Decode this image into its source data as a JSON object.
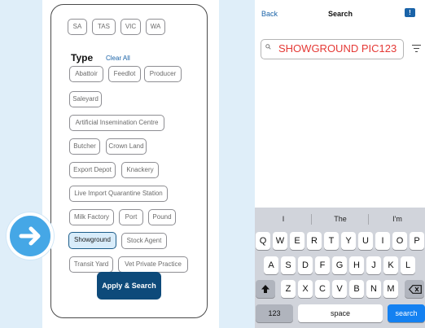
{
  "filter_panel": {
    "state_chips": [
      "SA",
      "TAS",
      "VIC",
      "WA"
    ],
    "type_heading": "Type",
    "clear_all": "Clear All",
    "type_chips": [
      "Abattoir",
      "Feedlot",
      "Producer",
      "Saleyard",
      "Artificial Insemination Centre",
      "Butcher",
      "Crown Land",
      "Export Depot",
      "Knackery",
      "Live Import Quarantine Station",
      "Milk Factory",
      "Port",
      "Pound",
      "Showground",
      "Stock Agent",
      "Transit Yard",
      "Vet Private Practice"
    ],
    "selected_type": "Showground",
    "apply_button": "Apply & Search"
  },
  "search_screen": {
    "back": "Back",
    "title": "Search",
    "flag_badge": "!",
    "search_value": "SHOWGROUND PIC123",
    "accent_color": "#1a63a8",
    "search_text_color": "#e53935"
  },
  "keyboard": {
    "suggestions": [
      "I",
      "The",
      "I'm"
    ],
    "row1": [
      "Q",
      "W",
      "E",
      "R",
      "T",
      "Y",
      "U",
      "I",
      "O",
      "P"
    ],
    "row2": [
      "A",
      "S",
      "D",
      "F",
      "G",
      "H",
      "J",
      "K",
      "L"
    ],
    "row3": [
      "Z",
      "X",
      "C",
      "V",
      "B",
      "N",
      "M"
    ],
    "numbers_key": "123",
    "space_key": "space",
    "search_key": "search",
    "shift_icon": "shift-icon",
    "backspace_icon": "backspace-icon"
  },
  "overlay": {
    "icon": "arrow-right-icon",
    "color": "#45a7e6"
  }
}
